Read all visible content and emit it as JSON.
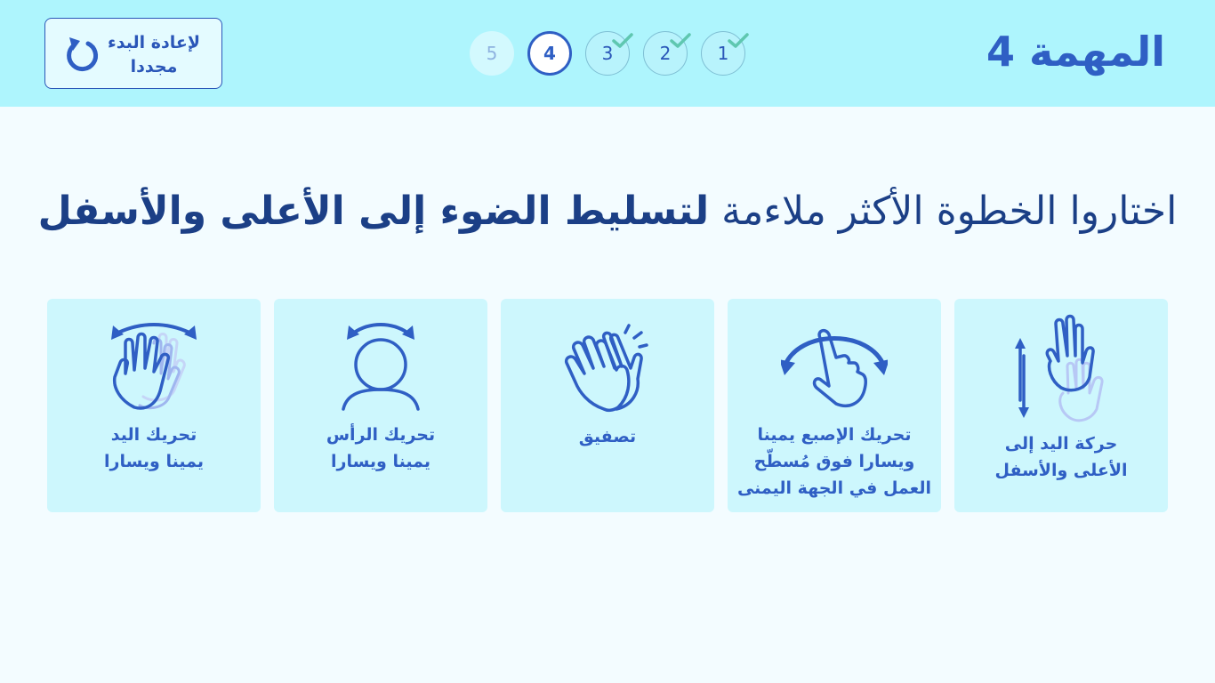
{
  "header": {
    "task_title": "المهمة 4",
    "restart_label": "لإعادة البدء\nمجددا"
  },
  "steps": [
    {
      "number": "1",
      "status": "completed"
    },
    {
      "number": "2",
      "status": "completed"
    },
    {
      "number": "3",
      "status": "completed"
    },
    {
      "number": "4",
      "status": "current"
    },
    {
      "number": "5",
      "status": "locked"
    }
  ],
  "question": {
    "prefix": "اختاروا الخطوة الأكثر ملاءمة ",
    "emphasis": "لتسليط الضوء إلى الأعلى والأسفل"
  },
  "options": [
    {
      "label": "حركة اليد إلى\nالأعلى والأسفل",
      "icon": "hand-up-down-icon"
    },
    {
      "label": "تحريك الإصبع يمينا\nويسارا فوق مُسطّح\nالعمل في الجهة اليمنى",
      "icon": "finger-swipe-icon"
    },
    {
      "label": "تصفيق",
      "icon": "clapping-hands-icon"
    },
    {
      "label": "تحريك الرأس\nيمينا ويسارا",
      "icon": "head-turn-icon"
    },
    {
      "label": "تحريك اليد\nيمينا ويسارا",
      "icon": "hand-wave-icon"
    }
  ],
  "colors": {
    "header_bg": "#aef5fd",
    "page_bg": "#f3fcff",
    "card_bg": "#cdf7fd",
    "accent": "#2f5fc4",
    "check": "#5fc7b0"
  }
}
